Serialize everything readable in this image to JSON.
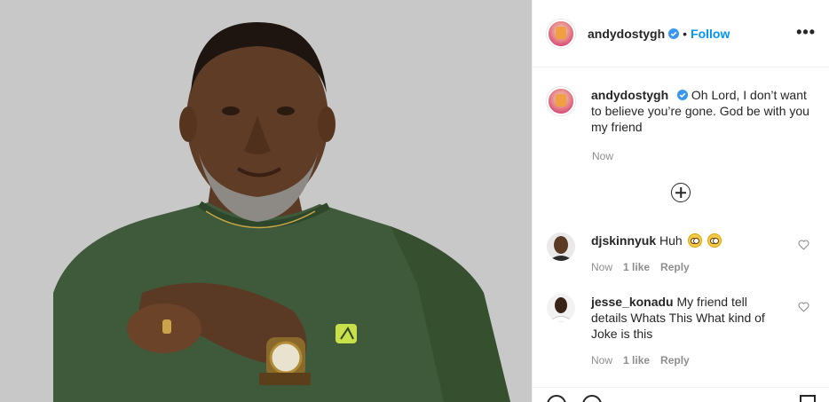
{
  "post": {
    "image_alt": "Man in green t-shirt with gold wristwatch",
    "author": {
      "username": "andydostygh",
      "verified": true,
      "follow_label": "Follow",
      "separator": "•",
      "more_label": "•••"
    },
    "caption": {
      "username": "andydostygh",
      "text": "Oh Lord, I don’t want to believe you’re gone. God be with you my friend",
      "time": "Now"
    }
  },
  "comments": [
    {
      "username": "djskinnyuk",
      "text": "Huh",
      "emojis": [
        "flushed-face-emoji",
        "flushed-face-emoji"
      ],
      "time": "Now",
      "likes": "1 like",
      "reply_label": "Reply"
    },
    {
      "username": "jesse_konadu",
      "text": "My friend tell details Whats This What kind of Joke is this",
      "time": "Now",
      "likes": "1 like",
      "reply_label": "Reply"
    }
  ],
  "colors": {
    "link_blue": "#0095f6",
    "verified_blue": "#3897f0",
    "muted_gray": "#8e8e8e",
    "text": "#262626",
    "border": "#efefef"
  }
}
